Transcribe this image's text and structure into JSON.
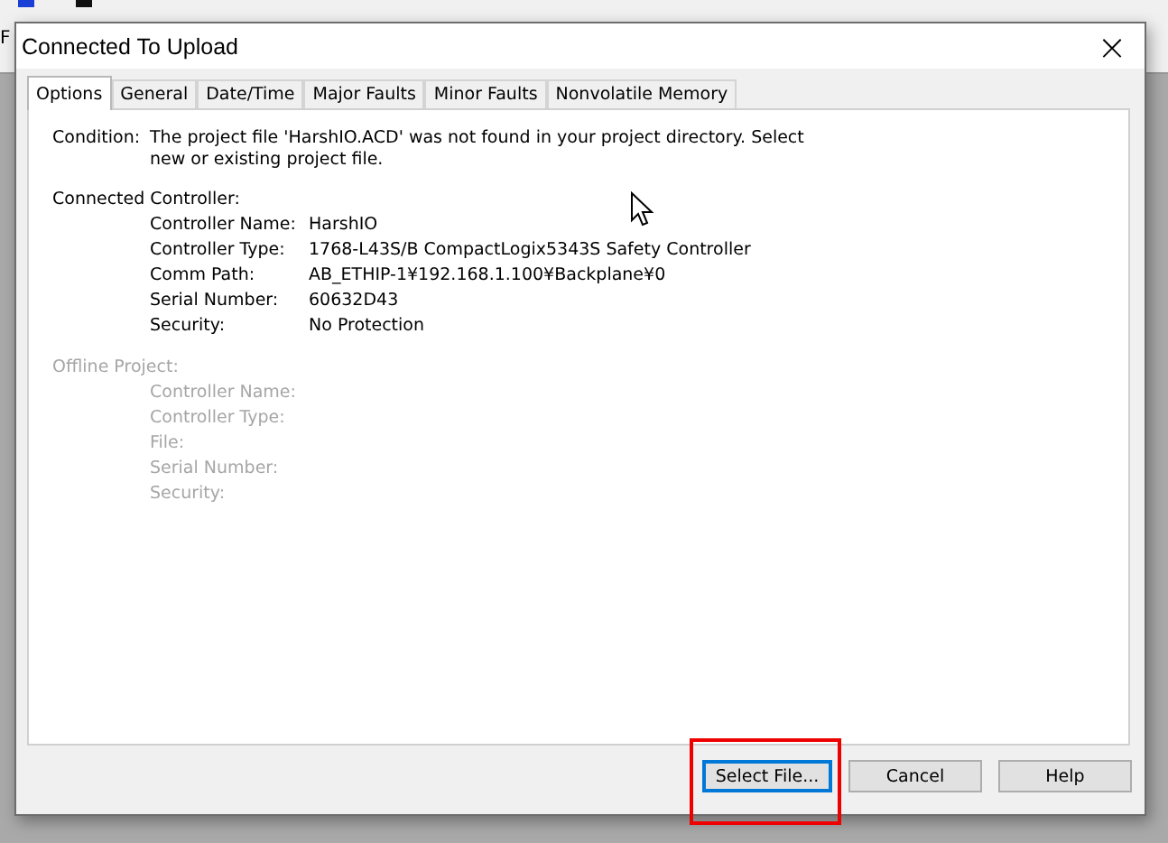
{
  "background": {
    "partial_text": "F"
  },
  "window": {
    "title": "Connected To Upload",
    "close": "×"
  },
  "tabs": [
    {
      "label": "Options",
      "selected": true
    },
    {
      "label": "General",
      "selected": false
    },
    {
      "label": "Date/Time",
      "selected": false
    },
    {
      "label": "Major Faults",
      "selected": false
    },
    {
      "label": "Minor Faults",
      "selected": false
    },
    {
      "label": "Nonvolatile Memory",
      "selected": false
    }
  ],
  "condition": {
    "label": "Condition:",
    "text": "The project file 'HarshIO.ACD' was not found in your project directory. Select new or existing project file."
  },
  "sections": [
    {
      "title": "Connected Controller:",
      "disabled": false,
      "fields": [
        {
          "label": "Controller Name:",
          "value": "HarshIO"
        },
        {
          "label": "Controller Type:",
          "value": "1768-L43S/B CompactLogix5343S Safety Controller"
        },
        {
          "label": "Comm Path:",
          "value": "AB_ETHIP-1¥192.168.1.100¥Backplane¥0"
        },
        {
          "label": "Serial Number:",
          "value": "60632D43"
        },
        {
          "label": "Security:",
          "value": "No Protection"
        }
      ]
    },
    {
      "title": "Offline Project:",
      "disabled": true,
      "fields": [
        {
          "label": "Controller Name:"
        },
        {
          "label": "Controller Type:"
        },
        {
          "label": "File:"
        },
        {
          "label": "Serial Number:"
        },
        {
          "label": "Security:"
        }
      ]
    }
  ],
  "buttons": [
    {
      "label": "Select File...",
      "focused": true,
      "highlighted": true
    },
    {
      "label": "Cancel",
      "focused": false,
      "highlighted": false
    },
    {
      "label": "Help",
      "focused": false,
      "highlighted": false
    }
  ]
}
